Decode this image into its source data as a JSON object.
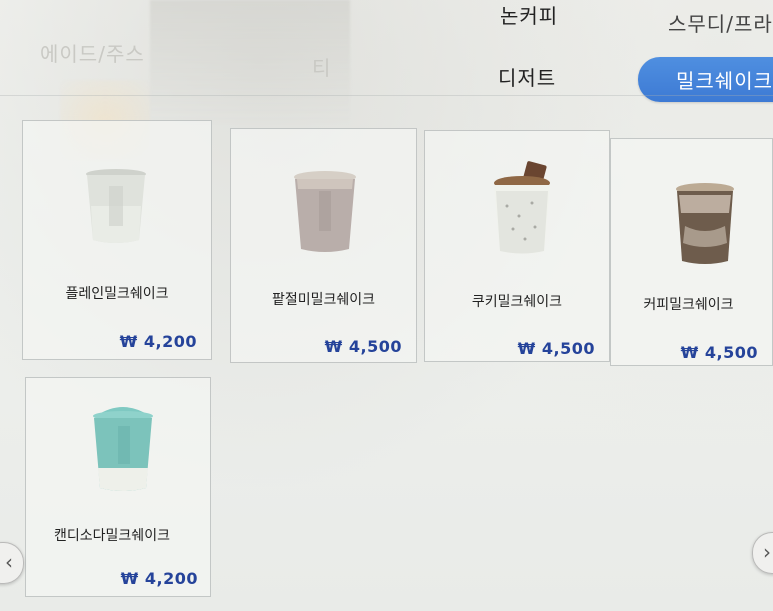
{
  "tabs": {
    "ade_juice": "에이드/주스",
    "tea": "티",
    "non_coffee": "논커피",
    "dessert": "디저트",
    "smoothie": "스무디/프라",
    "milkshake": "밀크쉐이크"
  },
  "products": [
    {
      "name": "플레인밀크쉐이크",
      "price": "₩ 4,200"
    },
    {
      "name": "팥절미밀크쉐이크",
      "price": "₩ 4,500"
    },
    {
      "name": "쿠키밀크쉐이크",
      "price": "₩ 4,500"
    },
    {
      "name": "커피밀크쉐이크",
      "price": "₩ 4,500"
    },
    {
      "name": "캔디소다밀크쉐이크",
      "price": "₩ 4,200"
    }
  ],
  "nav": {
    "prev_symbol": "‹",
    "next_symbol": "›"
  },
  "colors": {
    "active_tab": "#3d7ad4",
    "price_text": "#25439a"
  }
}
